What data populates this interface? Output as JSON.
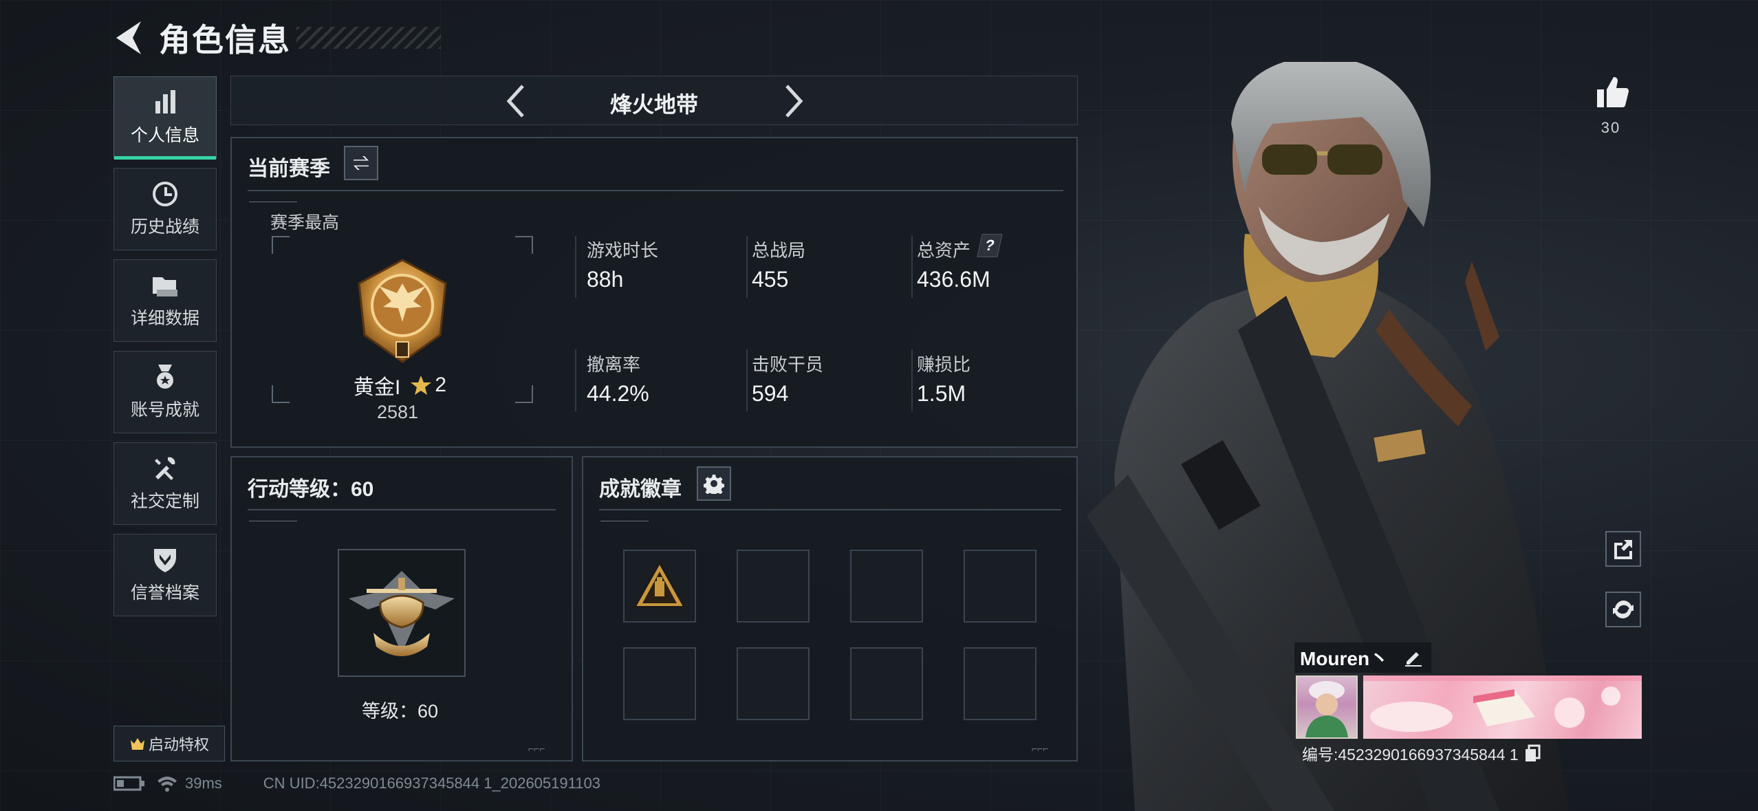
{
  "header": {
    "title": "角色信息"
  },
  "sidebar": {
    "items": [
      {
        "label": "个人信息",
        "icon": "bar-chart-icon",
        "active": true
      },
      {
        "label": "历史战绩",
        "icon": "history-clock-icon"
      },
      {
        "label": "详细数据",
        "icon": "folders-icon"
      },
      {
        "label": "账号成就",
        "icon": "medal-icon"
      },
      {
        "label": "社交定制",
        "icon": "tools-icon"
      },
      {
        "label": "信誉档案",
        "icon": "shield-icon"
      }
    ],
    "privilege_label": "启动特权"
  },
  "mode": {
    "title": "烽火地带"
  },
  "season": {
    "title": "当前赛季",
    "subtitle": "赛季最高",
    "rank_name": "黄金I",
    "rank_stars": "2",
    "rank_score": "2581",
    "stats": [
      {
        "label": "游戏时长",
        "value": "88h"
      },
      {
        "label": "总战局",
        "value": "455"
      },
      {
        "label": "总资产",
        "value": "436.6M",
        "help": "?"
      },
      {
        "label": "撤离率",
        "value": "44.2%"
      },
      {
        "label": "击败干员",
        "value": "594"
      },
      {
        "label": "赚损比",
        "value": "1.5M"
      }
    ]
  },
  "action_level": {
    "title": "行动等级：60",
    "level_text": "等级：60"
  },
  "badges": {
    "title": "成就徽章",
    "slots": 8,
    "filled": 1
  },
  "likes": {
    "count": "30"
  },
  "player": {
    "name": "Mouren丶",
    "id_text": "编号:4523290166937345844 1"
  },
  "status": {
    "ping": "39ms",
    "uid_text": "CN UID:4523290166937345844 1_202605191103"
  },
  "colors": {
    "accent": "#36d3a4",
    "gold": "#f1c35b"
  }
}
